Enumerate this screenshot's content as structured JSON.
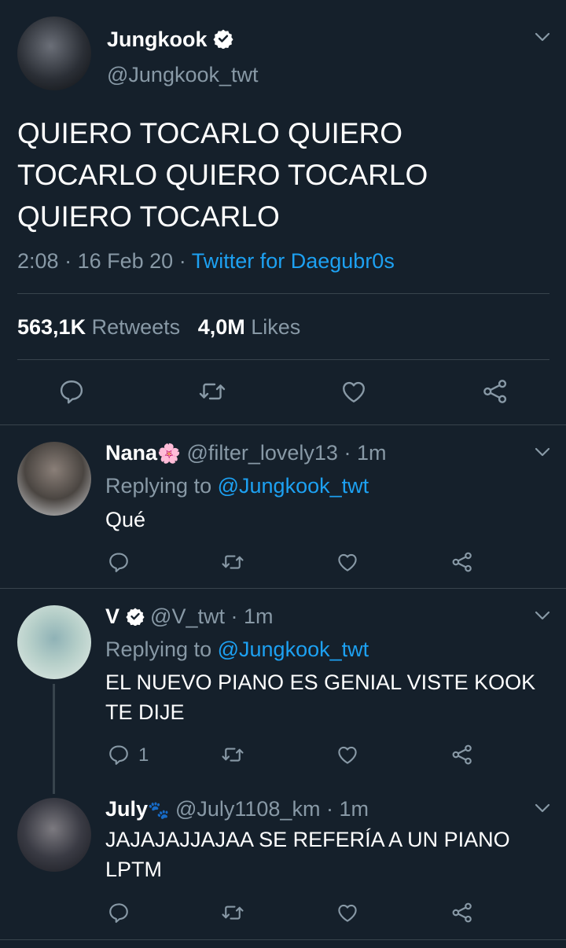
{
  "main_tweet": {
    "display_name": "Jungkook",
    "handle": "@Jungkook_twt",
    "text_lines": [
      "QUIERO TOCARLO QUIERO",
      "TOCARLO QUIERO TOCARLO",
      "QUIERO TOCARLO"
    ],
    "time": "2:08",
    "date": "16 Feb 20",
    "source": "Twitter for Daegubr0s",
    "retweets_count": "563,1K",
    "retweets_label": "Retweets",
    "likes_count": "4,0M",
    "likes_label": "Likes"
  },
  "replies": [
    {
      "display_name": "Nana",
      "emoji": "🌸",
      "handle": "@filter_lovely13",
      "time": "1m",
      "replying_prefix": "Replying to",
      "replying_to": "@Jungkook_twt",
      "text_lines": [
        "Qué"
      ],
      "reply_count": ""
    },
    {
      "display_name": "V",
      "handle": "@V_twt",
      "time": "1m",
      "replying_prefix": "Replying to",
      "replying_to": "@Jungkook_twt",
      "text_lines": [
        "EL NUEVO PIANO ES GENIAL VISTE KOOK",
        "TE DIJE"
      ],
      "reply_count": "1"
    },
    {
      "display_name": "July",
      "emoji": "🐾",
      "handle": "@July1108_km",
      "time": "1m",
      "text_lines": [
        "JAJAJAJJAJAA SE REFERÍA A UN PIANO",
        "LPTM"
      ],
      "reply_count": ""
    }
  ],
  "separator": "·",
  "colors": {
    "background": "#15202b",
    "text": "#ffffff",
    "secondary": "#8899a6",
    "accent": "#1da1f2",
    "divider": "#38444d"
  },
  "icons": [
    "verified-icon",
    "chevron-down-icon",
    "reply-icon",
    "retweet-icon",
    "like-icon",
    "share-icon"
  ]
}
